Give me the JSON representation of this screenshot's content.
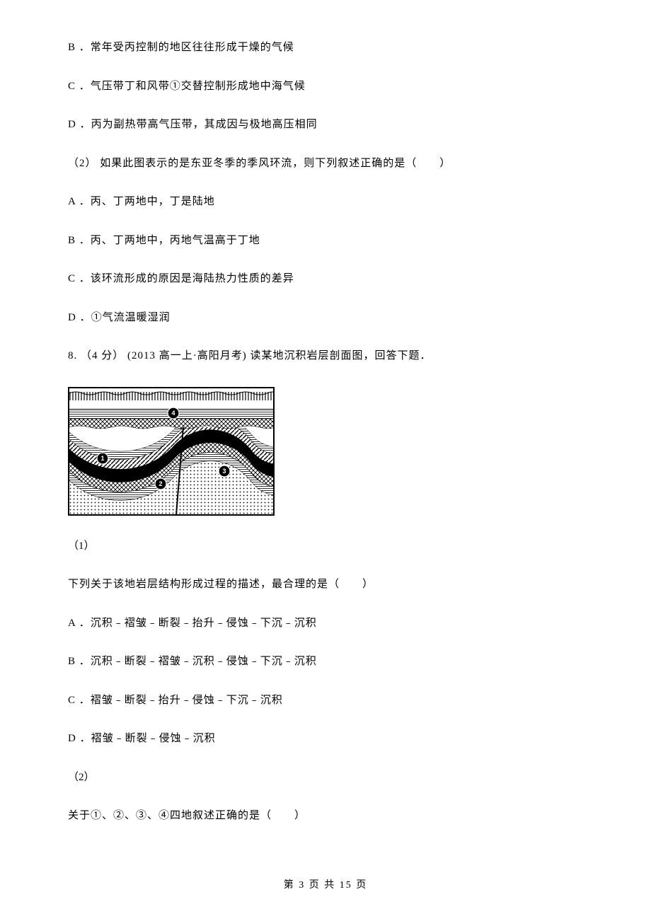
{
  "q7": {
    "optB": "B ．常年受丙控制的地区往往形成干燥的气候",
    "optC": "C ．气压带丁和风带①交替控制形成地中海气候",
    "optD": "D ．丙为副热带高气压带，其成因与极地高压相同",
    "sub2": "（2） 如果此图表示的是东亚冬季的季风环流，则下列叙述正确的是（　　）",
    "sub2_A": "A ．丙、丁两地中，丁是陆地",
    "sub2_B": "B ．丙、丁两地中，丙地气温高于丁地",
    "sub2_C": "C ．该环流形成的原因是海陆热力性质的差异",
    "sub2_D": "D ．①气流温暖湿润"
  },
  "q8": {
    "stem": "8. （4 分） (2013 高一上·高阳月考) 读某地沉积岩层剖面图，回答下题．",
    "sub1_label": "（1）",
    "sub1_stem": "下列关于该地岩层结构形成过程的描述，最合理的是（　　）",
    "sub1_A": "A ．沉积﹣褶皱﹣断裂﹣抬升﹣侵蚀﹣下沉﹣沉积",
    "sub1_B": "B ．沉积﹣断裂﹣褶皱﹣沉积﹣侵蚀﹣下沉﹣沉积",
    "sub1_C": "C ．褶皱﹣断裂﹣抬升﹣侵蚀﹣下沉﹣沉积",
    "sub1_D": "D ．褶皱﹣断裂﹣侵蚀﹣沉积",
    "sub2_label": "（2）",
    "sub2_stem": "关于①、②、③、④四地叙述正确的是（　　）"
  },
  "footer": {
    "text": "第 3 页 共 15 页"
  },
  "chart_data": {
    "type": "diagram",
    "title": "某地沉积岩层剖面图",
    "description": "Geological cross-section showing sedimentary rock layers with folding and a fault. Top horizontal flat layers overlie unconformity; below are folded strata forming a syncline on the left and an anticline toward the right, cut by a near-vertical fault with visible offset.",
    "markers": [
      "①",
      "②",
      "③",
      "④"
    ],
    "marker_positions": {
      "①": "left flank of syncline, within black folded band",
      "②": "trough center below syncline axis, on checkered band",
      "③": "right side near anticline crest, on checkered band, right of fault",
      "④": "center of upper horizontal layer above unconformity"
    },
    "structures": [
      "horizontal strata (top)",
      "unconformity",
      "folded strata (syncline + anticline)",
      "fault (near-vertical, slight offset)"
    ]
  }
}
